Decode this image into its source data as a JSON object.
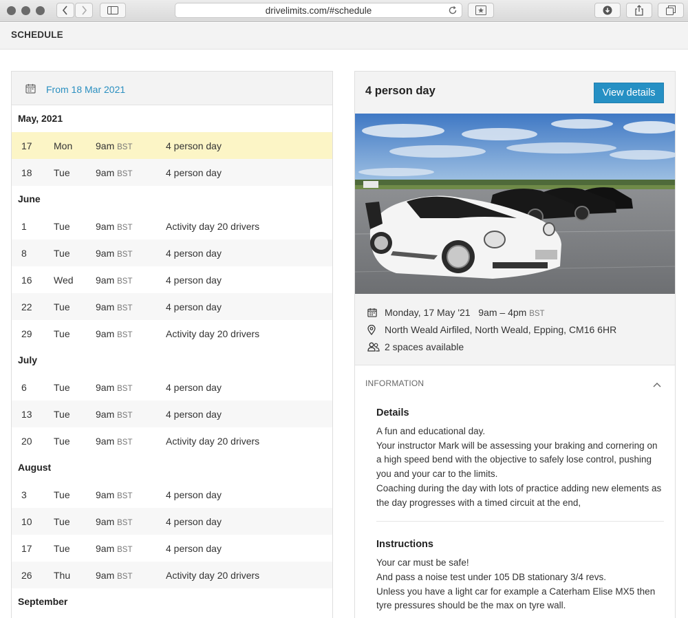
{
  "browser": {
    "url": "drivelimits.com/#schedule"
  },
  "header": {
    "title": "SCHEDULE"
  },
  "schedule": {
    "from_label": "From 18 Mar 2021",
    "tz": "BST",
    "months": [
      {
        "name": "May, 2021",
        "rows": [
          {
            "day": "17",
            "weekday": "Mon",
            "time": "9am",
            "name": "4 person day",
            "selected": true
          },
          {
            "day": "18",
            "weekday": "Tue",
            "time": "9am",
            "name": "4 person day"
          }
        ]
      },
      {
        "name": "June",
        "rows": [
          {
            "day": "1",
            "weekday": "Tue",
            "time": "9am",
            "name": "Activity day 20 drivers"
          },
          {
            "day": "8",
            "weekday": "Tue",
            "time": "9am",
            "name": "4 person day"
          },
          {
            "day": "16",
            "weekday": "Wed",
            "time": "9am",
            "name": "4 person day"
          },
          {
            "day": "22",
            "weekday": "Tue",
            "time": "9am",
            "name": "4 person day"
          },
          {
            "day": "29",
            "weekday": "Tue",
            "time": "9am",
            "name": "Activity day 20 drivers"
          }
        ]
      },
      {
        "name": "July",
        "rows": [
          {
            "day": "6",
            "weekday": "Tue",
            "time": "9am",
            "name": "4 person day"
          },
          {
            "day": "13",
            "weekday": "Tue",
            "time": "9am",
            "name": "4 person day"
          },
          {
            "day": "20",
            "weekday": "Tue",
            "time": "9am",
            "name": "Activity day 20 drivers"
          }
        ]
      },
      {
        "name": "August",
        "rows": [
          {
            "day": "3",
            "weekday": "Tue",
            "time": "9am",
            "name": "4 person day"
          },
          {
            "day": "10",
            "weekday": "Tue",
            "time": "9am",
            "name": "4 person day"
          },
          {
            "day": "17",
            "weekday": "Tue",
            "time": "9am",
            "name": "4 person day"
          },
          {
            "day": "26",
            "weekday": "Thu",
            "time": "9am",
            "name": "Activity day 20 drivers"
          }
        ]
      },
      {
        "name": "September",
        "rows": []
      }
    ]
  },
  "detail": {
    "title": "4 person day",
    "view_button": "View details",
    "date": "Monday, 17 May '21",
    "time": "9am – 4pm",
    "tz": "BST",
    "location": "North Weald Airfiled, North Weald, Epping, CM16 6HR",
    "spaces": "2 spaces available",
    "information_label": "INFORMATION",
    "details_heading": "Details",
    "details_text": [
      "A fun and educational day.",
      "Your instructor Mark will be assessing your braking and cornering on a high speed bend with the objective to safely lose control, pushing you and your car to the limits.",
      "Coaching during the day with lots of practice adding new elements as the day progresses with a timed circuit at the end,"
    ],
    "instructions_heading": "Instructions",
    "instructions_text": [
      "Your car must be safe!",
      "And pass a noise test under 105 DB stationary 3/4 revs.",
      "Unless you have a light car for example a Caterham Elise MX5 then tyre pressures should be the max on tyre wall."
    ]
  },
  "colors": {
    "accent": "#2690c4",
    "link": "#2a8fc0",
    "selected_row": "#fcf5c6",
    "panel_bg": "#f3f3f3"
  },
  "icons": [
    "back-icon",
    "forward-icon",
    "sidebar-icon",
    "reload-icon",
    "bookmark-icon",
    "download-icon",
    "share-icon",
    "tabs-icon",
    "calendar-icon",
    "location-pin-icon",
    "people-icon",
    "chevron-up-icon"
  ]
}
